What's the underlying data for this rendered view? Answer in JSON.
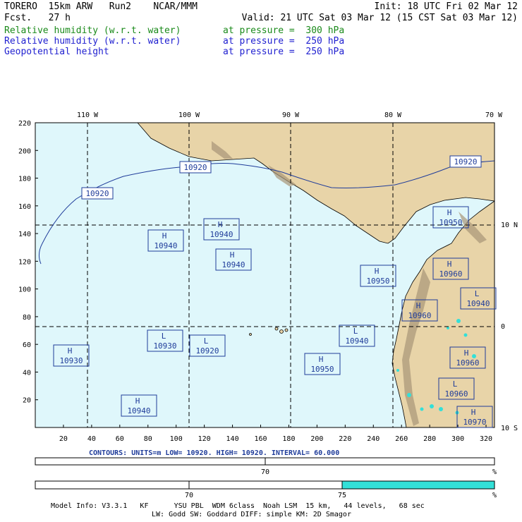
{
  "header": {
    "model": "TORERO  15km ARW   Run2    NCAR/MMM",
    "fcst": "Fcst.   27 h",
    "init": "Init: 18 UTC Fri 02 Mar 12",
    "valid": "Valid: 21 UTC Sat 03 Mar 12 (15 CST Sat 03 Mar 12)",
    "fields": [
      {
        "name": "Relative humidity (w.r.t. water)",
        "level": "at pressure =  300 hPa",
        "color": "#1a8a1a"
      },
      {
        "name": "Relative humidity (w.r.t. water)",
        "level": "at pressure =  250 hPa",
        "color": "#1f1fd0"
      },
      {
        "name": "Geopotential height",
        "level": "at pressure =  250 hPa",
        "color": "#1f1fd0"
      }
    ]
  },
  "map": {
    "lon_labels": [
      "110 W",
      "100 W",
      "90 W",
      "80 W",
      "70 W"
    ],
    "lat_labels": [
      "10 N",
      "0",
      "10 S"
    ],
    "x_ticks": [
      "20",
      "40",
      "60",
      "80",
      "100",
      "120",
      "140",
      "160",
      "180",
      "200",
      "220",
      "240",
      "260",
      "280",
      "300",
      "320"
    ],
    "y_ticks": [
      "20",
      "40",
      "60",
      "80",
      "100",
      "120",
      "140",
      "160",
      "180",
      "200",
      "220"
    ],
    "ocean_color": "#dff7fb",
    "land_color": "#e8d4a8",
    "contour_color": "#1f3c9a",
    "contour_labels": [
      "10920",
      "10920",
      "10920"
    ],
    "centers": [
      {
        "type": "H",
        "value": "10940"
      },
      {
        "type": "H",
        "value": "10940"
      },
      {
        "type": "H",
        "value": "10940"
      },
      {
        "type": "H",
        "value": "10930"
      },
      {
        "type": "L",
        "value": "10930"
      },
      {
        "type": "L",
        "value": "10920"
      },
      {
        "type": "H",
        "value": "10940"
      },
      {
        "type": "H",
        "value": "10950"
      },
      {
        "type": "L",
        "value": "10940"
      },
      {
        "type": "H",
        "value": "10950"
      },
      {
        "type": "H",
        "value": "10950"
      },
      {
        "type": "H",
        "value": "10960"
      },
      {
        "type": "H",
        "value": "10960"
      },
      {
        "type": "L",
        "value": "10940"
      },
      {
        "type": "H",
        "value": "10960"
      },
      {
        "type": "L",
        "value": "10960"
      },
      {
        "type": "H",
        "value": "10970"
      }
    ]
  },
  "contours_info": "CONTOURS:  UNITS=m  LOW=  10920.    HIGH=  10920.    INTERVAL=   60.000",
  "bar1": {
    "labels": [
      "70"
    ],
    "unit": "%"
  },
  "bar2": {
    "labels": [
      "70",
      "75"
    ],
    "unit": "%",
    "fill_color": "#33e0d8"
  },
  "footer": {
    "line1": "Model Info: V3.3.1   KF      YSU PBL  WDM 6class  Noah LSM  15 km,   44 levels,   68 sec",
    "line2": "LW: Godd SW: Goddard DIFF: simple KM: 2D Smagor"
  }
}
